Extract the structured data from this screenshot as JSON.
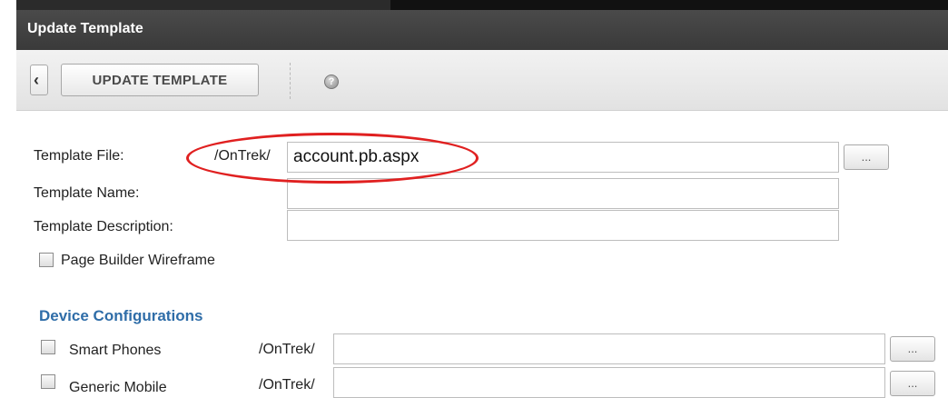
{
  "window": {
    "title": "Update Template"
  },
  "toolbar": {
    "back_icon": "chevron-left-icon",
    "update_label": "UPDATE TEMPLATE",
    "help_icon": "help-icon",
    "help_glyph": "?"
  },
  "form": {
    "template_file": {
      "label": "Template File:",
      "prefix": "/OnTrek/",
      "value": "account.pb.aspx",
      "browse_label": "..."
    },
    "template_name": {
      "label": "Template Name:",
      "value": ""
    },
    "template_description": {
      "label": "Template Description:",
      "value": ""
    },
    "page_builder_wireframe": {
      "label": "Page Builder Wireframe",
      "checked": false
    }
  },
  "device_configurations": {
    "title": "Device Configurations",
    "items": [
      {
        "label": "Smart Phones",
        "prefix": "/OnTrek/",
        "value": "",
        "browse_label": "...",
        "checked": false
      },
      {
        "label": "Generic Mobile",
        "prefix": "/OnTrek/",
        "value": "",
        "browse_label": "...",
        "checked": false
      }
    ]
  },
  "colors": {
    "titlebar": "#3f3f3f",
    "section_title": "#2f6da8",
    "highlight_ellipse": "#e02020"
  }
}
